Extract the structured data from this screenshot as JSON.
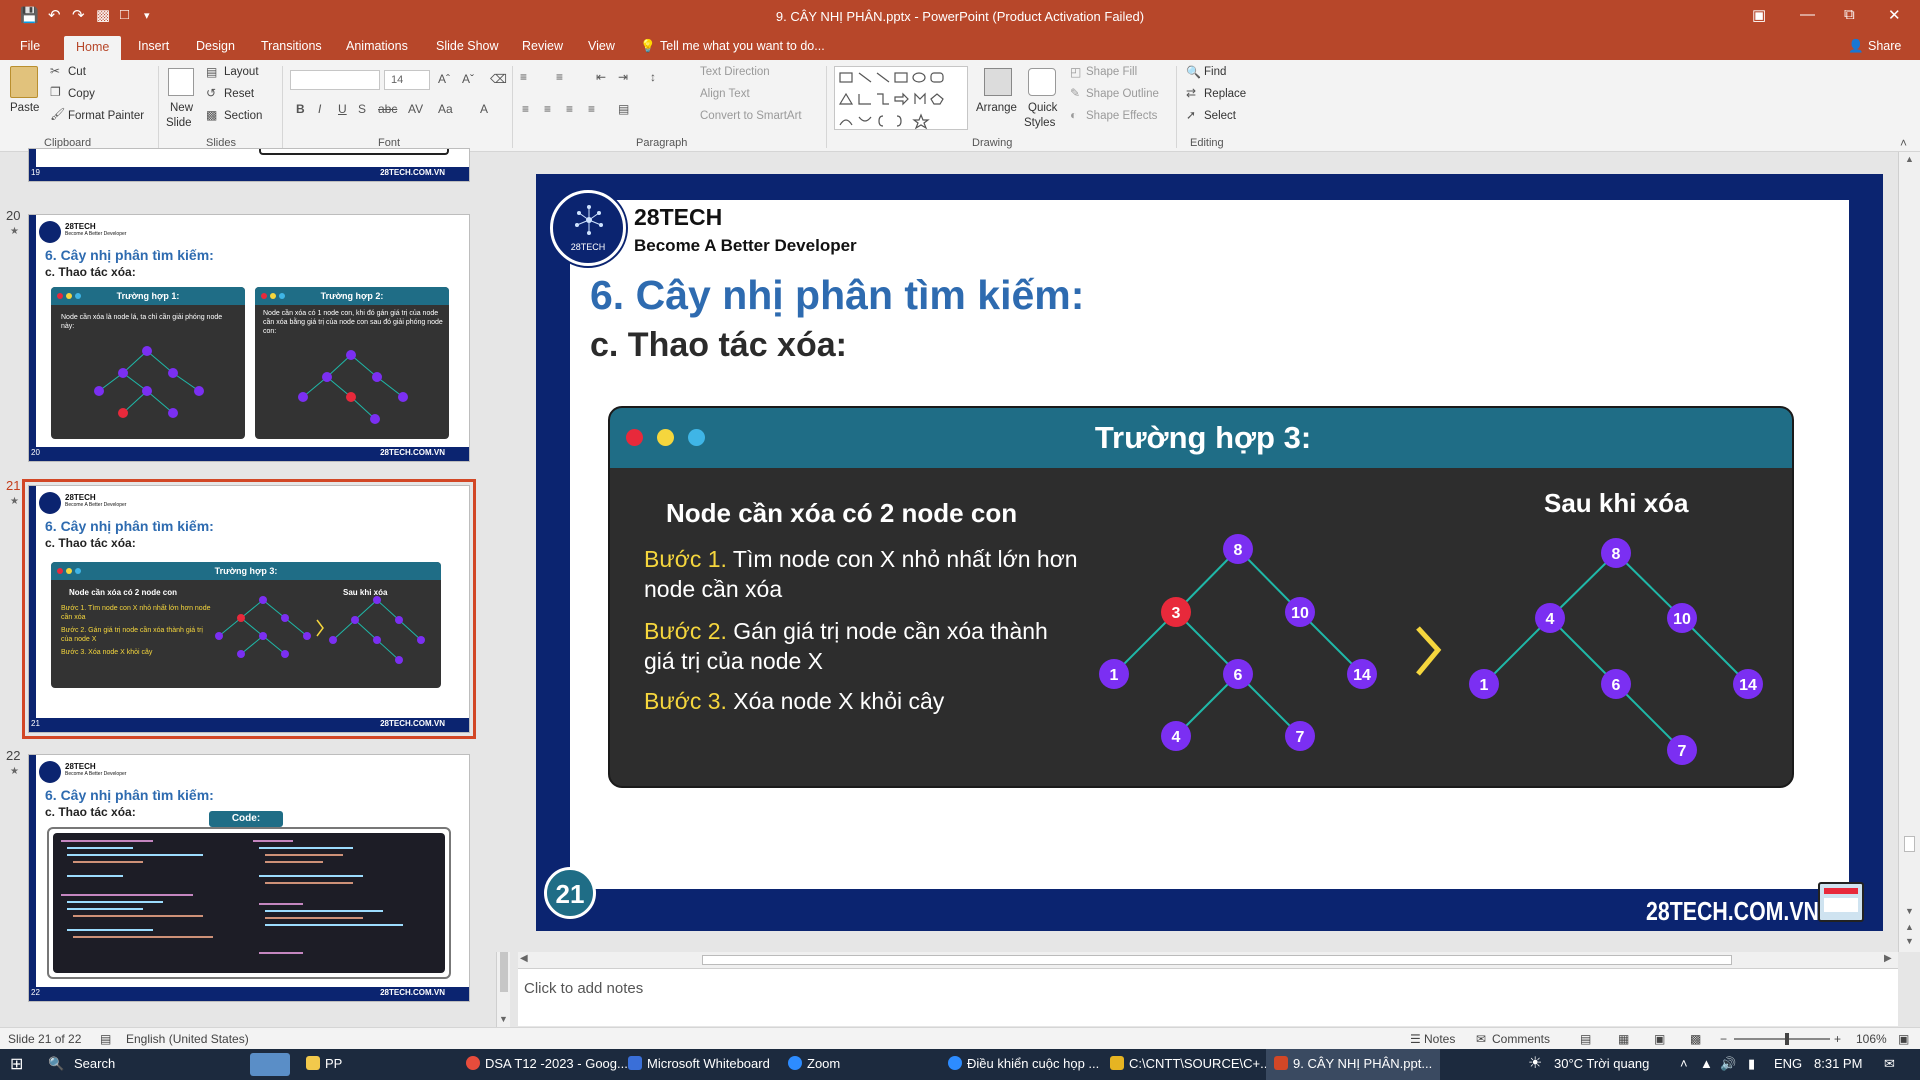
{
  "window": {
    "title": "9. CÂY NHỊ PHÂN.pptx - PowerPoint (Product Activation Failed)",
    "share_label": "Share",
    "tell_me": "Tell me what you want to do..."
  },
  "tabs": [
    "File",
    "Home",
    "Insert",
    "Design",
    "Transitions",
    "Animations",
    "Slide Show",
    "Review",
    "View"
  ],
  "ribbon": {
    "clipboard": {
      "paste": "Paste",
      "cut": "Cut",
      "copy": "Copy",
      "format_painter": "Format Painter",
      "group": "Clipboard"
    },
    "slides": {
      "new_slide_1": "New",
      "new_slide_2": "Slide",
      "layout": "Layout",
      "reset": "Reset",
      "section": "Section",
      "group": "Slides"
    },
    "font": {
      "font_size": "14",
      "group": "Font"
    },
    "paragraph": {
      "text_direction": "Text Direction",
      "align_text": "Align Text",
      "convert": "Convert to SmartArt",
      "group": "Paragraph"
    },
    "drawing": {
      "arrange": "Arrange",
      "quick_styles_1": "Quick",
      "quick_styles_2": "Styles",
      "shape_fill": "Shape Fill",
      "shape_outline": "Shape Outline",
      "shape_effects": "Shape Effects",
      "group": "Drawing"
    },
    "editing": {
      "find": "Find",
      "replace": "Replace",
      "select": "Select",
      "group": "Editing"
    }
  },
  "thumbnails": [
    {
      "num": "20",
      "brand": "28TECH",
      "sub": "Become A Better Developer",
      "h1": "6. Cây nhị phân tìm kiếm:",
      "h2": "c. Thao tác xóa:",
      "card1": "Trường hợp 1:",
      "card1_text": "Node cần xóa là node lá, ta chỉ cần giải phóng node này:",
      "card2": "Trường hợp 2:",
      "card2_text": "Node cần xóa có 1 node con, khi đó gán giá trị của node cần xóa bằng giá trị của node con sau đó giải phóng node con:"
    },
    {
      "num": "21",
      "brand": "28TECH",
      "sub": "Become A Better Developer",
      "h1": "6. Cây nhị phân tìm kiếm:",
      "h2": "c. Thao tác xóa:",
      "card": "Trường hợp 3:",
      "left_title": "Node cần xóa có 2 node con",
      "step1": "Bước 1. Tìm node con X nhỏ nhất lớn hơn node cần xóa",
      "step2": "Bước 2. Gán giá trị node cần xóa thành giá trị của node X",
      "step3": "Bước 3. Xóa node X khỏi cây",
      "after": "Sau khi xóa"
    },
    {
      "num": "22",
      "brand": "28TECH",
      "sub": "Become A Better Developer",
      "h1": "6. Cây nhị phân tìm kiếm:",
      "h2": "c. Thao tác xóa:",
      "code_label": "Code:"
    }
  ],
  "thumb_top_num": "19",
  "thumb_footer": "28TECH.COM.VN",
  "slide": {
    "brand": "28TECH",
    "logo_text": "28TECH",
    "tagline": "Become A Better Developer",
    "heading": "6. Cây nhị phân tìm kiếm:",
    "subheading": "c. Thao tác xóa:",
    "card_title": "Trường hợp 3:",
    "left_title": "Node cần xóa có 2 node con",
    "steps": [
      {
        "label": "Bước 1.",
        "text": "Tìm node con X nhỏ nhất lớn hơn node cần xóa"
      },
      {
        "label": "Bước 2.",
        "text": "Gán giá trị node cần xóa thành giá trị của node X"
      },
      {
        "label": "Bước 3.",
        "text": "Xóa node X khỏi cây"
      }
    ],
    "after_title": "Sau khi xóa",
    "tree_before": [
      "8",
      "3",
      "10",
      "1",
      "6",
      "14",
      "4",
      "7"
    ],
    "tree_after": [
      "8",
      "4",
      "10",
      "1",
      "6",
      "14",
      "7"
    ],
    "slide_number": "21",
    "footer": "28TECH.COM.VN",
    "colors": {
      "heading": "#2e6bb0",
      "step_label": "#f5d63d",
      "node": "#7b2ff2",
      "node_highlight": "#e8293b",
      "edge": "#1fb8a8",
      "card_bg": "#2d2d2d",
      "card_header": "#1f6d86",
      "frame": "#0b2470"
    }
  },
  "notes_placeholder": "Click to add notes",
  "status": {
    "slide": "Slide 21 of 22",
    "language": "English (United States)",
    "notes": "Notes",
    "comments": "Comments",
    "zoom": "106%"
  },
  "taskbar": {
    "search": "Search",
    "items": [
      "PP",
      "DSA T12 -2023 - Goog...",
      "Microsoft Whiteboard",
      "Zoom",
      "Điều khiển cuộc họp ...",
      "C:\\CNTT\\SOURCE\\C+...",
      "9. CÂY NHỊ PHÂN.ppt..."
    ],
    "weather": "30°C  Trời quang",
    "lang": "ENG",
    "time": "8:31 PM"
  }
}
